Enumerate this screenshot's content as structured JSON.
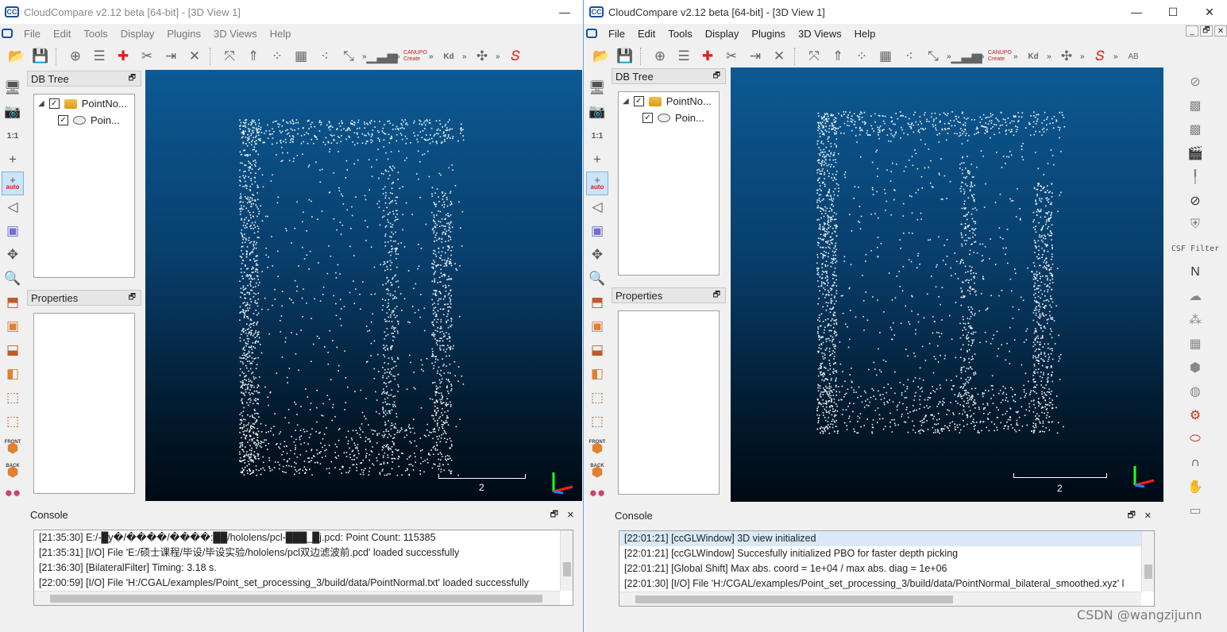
{
  "left": {
    "title": "CloudCompare v2.12 beta [64-bit] - [3D View 1]",
    "menu": [
      "File",
      "Edit",
      "Tools",
      "Display",
      "Plugins",
      "3D Views",
      "Help"
    ],
    "db_tree_title": "DB Tree",
    "tree_parent": "PointNo...",
    "tree_child": "Poin...",
    "properties_title": "Properties",
    "console_title": "Console",
    "scale_label": "2",
    "one_to_one": "1:1",
    "auto_label": "auto",
    "front_label": "FRONT",
    "back_label": "BACK",
    "console_lines": [
      "[21:35:30] E:/-█y�/����/����:██/hololens/pcl-███_█j.pcd: Point Count: 115385",
      "[21:35:31] [I/O] File 'E:/硕士课程/毕设/毕设实验/hololens/pcl双边滤波前.pcd' loaded successfully",
      "[21:36:30] [BilateralFilter] Timing: 3.18 s.",
      "[22:00:59] [I/O] File 'H:/CGAL/examples/Point_set_processing_3/build/data/PointNormal.txt' loaded successfully"
    ]
  },
  "right": {
    "title": "CloudCompare v2.12 beta [64-bit] - [3D View 1]",
    "menu": [
      "File",
      "Edit",
      "Tools",
      "Display",
      "Plugins",
      "3D Views",
      "Help"
    ],
    "db_tree_title": "DB Tree",
    "tree_parent": "PointNo...",
    "tree_child": "Poin...",
    "properties_title": "Properties",
    "console_title": "Console",
    "scale_label": "2",
    "one_to_one": "1:1",
    "auto_label": "auto",
    "front_label": "FRONT",
    "back_label": "BACK",
    "csf_filter": "CSF Filter",
    "console_lines": [
      "[22:01:21] [ccGLWindow] 3D view initialized",
      "[22:01:21] [ccGLWindow] Succesfully initialized PBO for faster depth picking",
      "[22:01:21] [Global Shift] Max abs. coord = 1e+04 / max abs. diag = 1e+06",
      "[22:01:30] [I/O] File 'H:/CGAL/examples/Point_set_processing_3/build/data/PointNormal_bilateral_smoothed.xyz' l"
    ]
  },
  "toolbar_icons": [
    "open-icon",
    "save-icon",
    "pick-rotation-icon",
    "list-icon",
    "add-point-icon",
    "segment-icon",
    "merge-icon",
    "delete-icon",
    "translate-icon",
    "normal-icon",
    "sample-icon",
    "subsample-icon",
    "noise-icon",
    "scale-icon"
  ],
  "toolbar_icons_right": [
    "histogram-icon",
    "canupo-icon",
    "kd-icon",
    "puzzle-icon",
    "curve-icon"
  ],
  "canupo_label": "CANUPO Create",
  "kd_label": "Kd",
  "watermark": "CSDN @wangzijunn",
  "colors": {
    "accent": "#1a4f9b",
    "view_top": "#0c5a94",
    "view_bottom": "#000a14",
    "axis_x": "#ff2020",
    "axis_y": "#20ff20",
    "axis_z": "#2080ff"
  }
}
